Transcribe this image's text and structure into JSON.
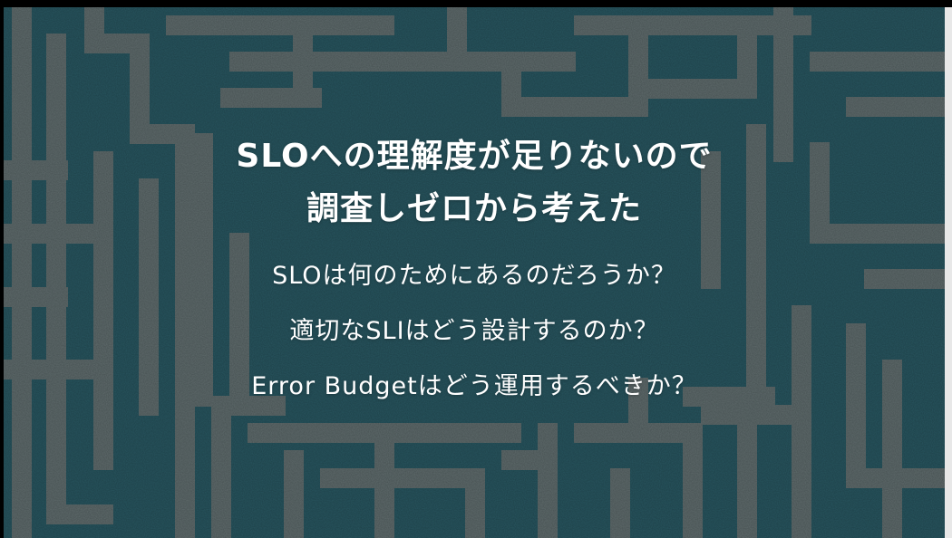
{
  "slide": {
    "title_lines": [
      "SLOへの理解度が足りないので",
      "調査しゼロから考えた"
    ],
    "questions": [
      "SLOは何のためにあるのだろうか？",
      "適切なSLIはどう設計するのか？",
      "Error Budgetはどう運用するべきか？"
    ]
  },
  "colors": {
    "teal": "#2f5f6a",
    "stripe": "#737a7a",
    "text": "#ffffff"
  }
}
